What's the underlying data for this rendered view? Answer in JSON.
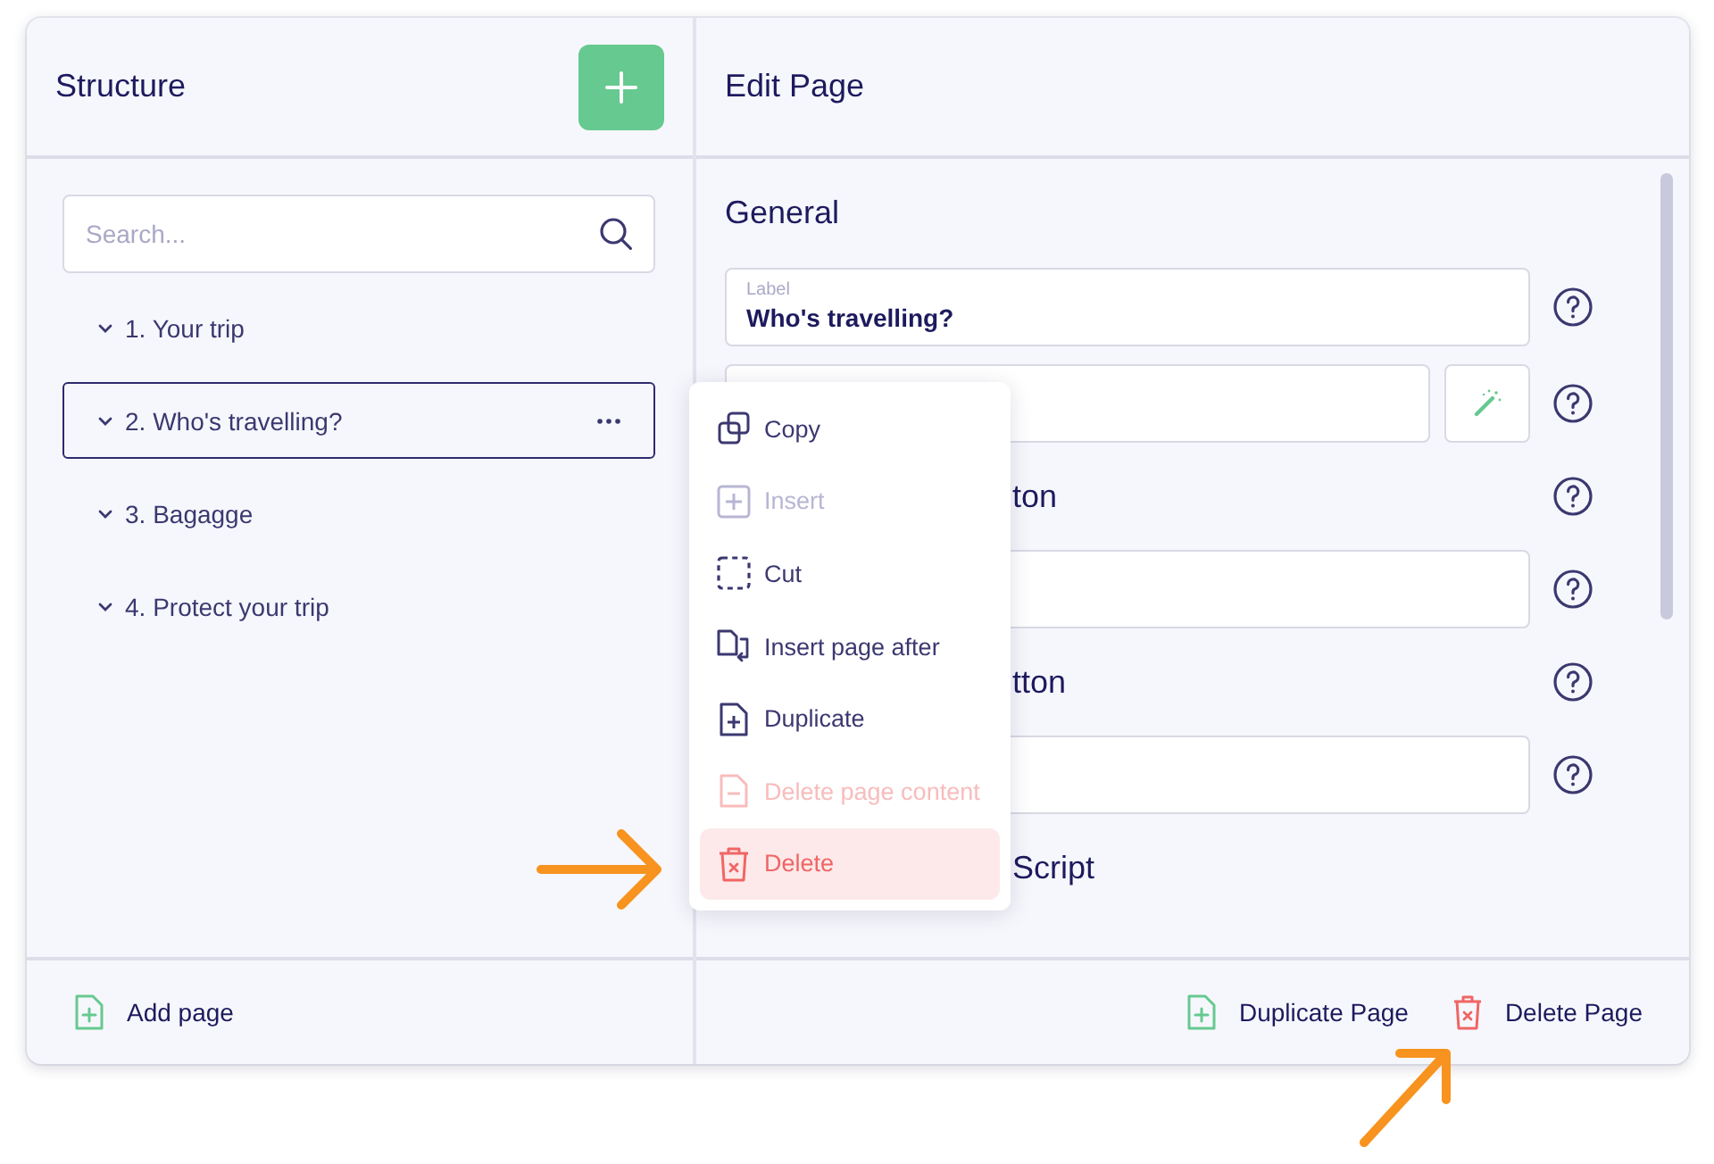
{
  "structure": {
    "title": "Structure",
    "search": {
      "placeholder": "Search..."
    },
    "pages": [
      {
        "label": "1. Your trip",
        "selected": false
      },
      {
        "label": "2. Who's travelling?",
        "selected": true
      },
      {
        "label": "3. Bagagge",
        "selected": false
      },
      {
        "label": "4. Protect your trip",
        "selected": false
      }
    ]
  },
  "context_menu": {
    "items": [
      {
        "label": "Copy",
        "kind": "copy",
        "disabled": false,
        "selected": false
      },
      {
        "label": "Insert",
        "kind": "insert",
        "disabled": true,
        "selected": false
      },
      {
        "label": "Cut",
        "kind": "cut",
        "disabled": false,
        "selected": false
      },
      {
        "label": "Insert page after",
        "kind": "insert_after",
        "disabled": false,
        "selected": false
      },
      {
        "label": "Duplicate",
        "kind": "duplicate",
        "disabled": false,
        "selected": false
      },
      {
        "label": "Delete page content",
        "kind": "clear",
        "disabled": true,
        "selected": false
      },
      {
        "label": "Delete",
        "kind": "delete",
        "disabled": false,
        "selected": true
      }
    ]
  },
  "edit_page": {
    "title": "Edit Page",
    "section_title": "General",
    "rows": [
      {
        "kind": "labeled_field",
        "label": "Label",
        "value": "Who's travelling?",
        "help": true
      },
      {
        "kind": "field_with_wand",
        "help": true
      },
      {
        "kind": "heading",
        "text": "ton",
        "help": true
      },
      {
        "kind": "field",
        "help": true
      },
      {
        "kind": "heading",
        "text": "tton",
        "help": true
      },
      {
        "kind": "field",
        "help": true
      },
      {
        "kind": "heading",
        "text": "Script",
        "help": false
      }
    ]
  },
  "footer": {
    "left_actions": [
      {
        "label": "Add page",
        "kind": "add"
      }
    ],
    "right_actions": [
      {
        "label": "Duplicate Page",
        "kind": "duplicate"
      },
      {
        "label": "Delete Page",
        "kind": "delete"
      }
    ]
  }
}
